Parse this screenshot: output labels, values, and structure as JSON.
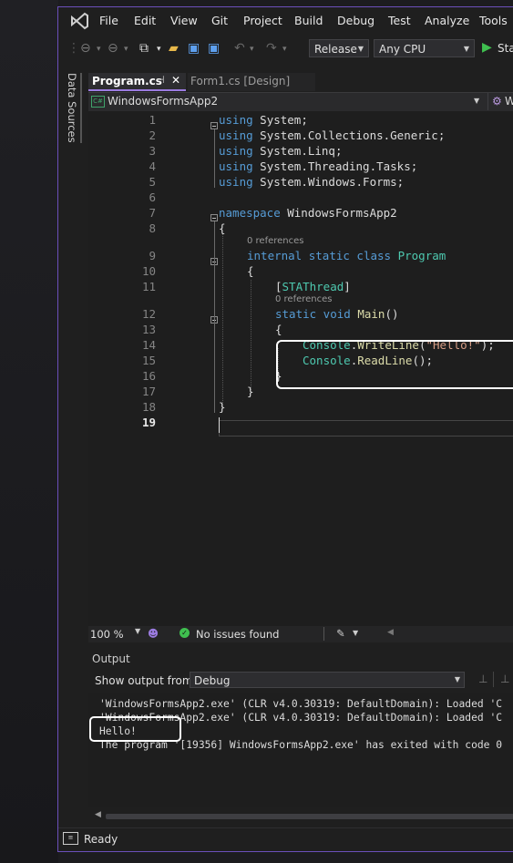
{
  "menu": [
    "File",
    "Edit",
    "View",
    "Git",
    "Project",
    "Build",
    "Debug",
    "Test",
    "Analyze",
    "Tools"
  ],
  "toolbar": {
    "config": "Release",
    "platform": "Any CPU",
    "start_label": "Sta"
  },
  "side_tab": "Data Sources",
  "tabs": [
    {
      "label": "Program.cs",
      "pin": "⊣",
      "close": "✕"
    },
    {
      "label": "Form1.cs [Design]"
    }
  ],
  "nav": {
    "project": "WindowsFormsApp2",
    "member": "W"
  },
  "line_numbers": [
    "1",
    "2",
    "3",
    "4",
    "5",
    "6",
    "7",
    "8",
    "9",
    "10",
    "11",
    "12",
    "13",
    "14",
    "15",
    "16",
    "17",
    "18",
    "19"
  ],
  "code": {
    "l1": [
      "using",
      " System;"
    ],
    "l2": [
      "using",
      " System.Collections.Generic;"
    ],
    "l3": [
      "using",
      " System.Linq;"
    ],
    "l4": [
      "using",
      " System.Threading.Tasks;"
    ],
    "l5": [
      "using",
      " System.Windows.Forms;"
    ],
    "l7": [
      "namespace",
      " WindowsFormsApp2"
    ],
    "l8": "{",
    "ref1": "0 references",
    "l9": [
      "internal",
      " static",
      " class",
      " Program"
    ],
    "l10": "{",
    "l11": [
      "[",
      "STAThread",
      "]"
    ],
    "ref2": "0 references",
    "l12": [
      "static",
      " void",
      " Main",
      "()"
    ],
    "l13": "{",
    "l14": [
      "Console",
      ".",
      "WriteLine",
      "(",
      "\"Hello!\"",
      ");"
    ],
    "l15": [
      "Console",
      ".",
      "ReadLine",
      "();"
    ],
    "l16": "}",
    "l17": "}",
    "l18": "}"
  },
  "editor_status": {
    "zoom": "100 %",
    "issues": "No issues found"
  },
  "output": {
    "title": "Output",
    "show_label": "Show output from:",
    "source": "Debug",
    "lines": [
      "'WindowsFormsApp2.exe' (CLR v4.0.30319: DefaultDomain): Loaded 'C",
      "'WindowsFormsApp2.exe' (CLR v4.0.30319: DefaultDomain): Loaded 'C",
      "Hello!",
      "The program '[19356] WindowsFormsApp2.exe' has exited with code 0"
    ]
  },
  "status": {
    "text": "Ready"
  }
}
